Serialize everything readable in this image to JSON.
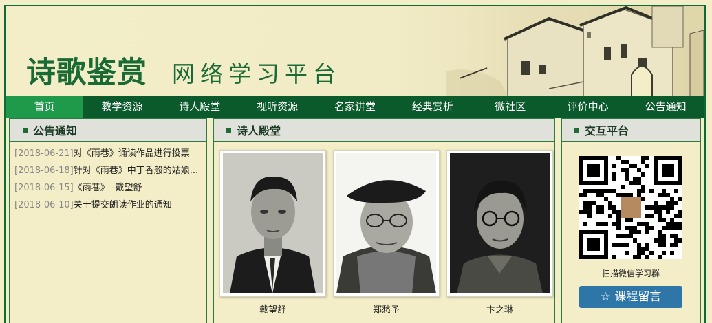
{
  "banner": {
    "title": "诗歌鉴赏",
    "subtitle": "网络学习平台"
  },
  "nav": {
    "items": [
      {
        "label": "首页",
        "active": true
      },
      {
        "label": "教学资源"
      },
      {
        "label": "诗人殿堂"
      },
      {
        "label": "视听资源"
      },
      {
        "label": "名家讲堂"
      },
      {
        "label": "经典赏析"
      },
      {
        "label": "微社区"
      },
      {
        "label": "评价中心"
      },
      {
        "label": "公告通知"
      }
    ]
  },
  "notices": {
    "heading": "公告通知",
    "items": [
      {
        "date": "[2018-06-21]",
        "title": "对《雨巷》诵读作品进行投票"
      },
      {
        "date": "[2018-06-18]",
        "title": "针对《雨巷》中丁香般的姑娘..."
      },
      {
        "date": "[2018-06-15]",
        "title": "《雨巷》 -戴望舒"
      },
      {
        "date": "[2018-06-10]",
        "title": "关于提交朗读作业的通知"
      }
    ]
  },
  "poets": {
    "heading": "诗人殿堂",
    "items": [
      {
        "name": "戴望舒"
      },
      {
        "name": "郑愁予"
      },
      {
        "name": "卞之琳"
      }
    ]
  },
  "interact": {
    "heading": "交互平台",
    "qr_caption": "扫描微信学习群",
    "button_label": "☆ 课程留言"
  },
  "colors": {
    "brand_green": "#0b5a2b",
    "active_nav": "#1f9a4a",
    "page_bg": "#f3eec8",
    "button_blue": "#2f76a8"
  }
}
